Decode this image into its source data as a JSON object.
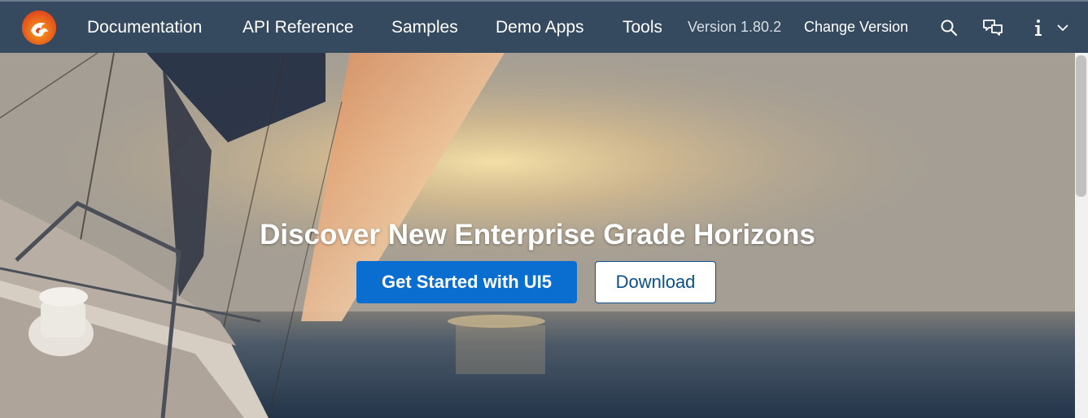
{
  "header": {
    "logo_icon": "ui5-phoenix-logo",
    "nav": [
      {
        "label": "Documentation"
      },
      {
        "label": "API Reference"
      },
      {
        "label": "Samples"
      },
      {
        "label": "Demo Apps"
      },
      {
        "label": "Tools"
      }
    ],
    "version_label": "Version 1.80.2",
    "change_version_label": "Change Version",
    "icons": [
      "search-icon",
      "feedback-icon",
      "info-icon",
      "chevron-down-icon"
    ],
    "background_color": "#354a5f"
  },
  "hero": {
    "title": "Discover New Enterprise Grade Horizons",
    "primary_button": "Get Started with UI5",
    "secondary_button": "Download",
    "primary_color": "#0a6ed1"
  }
}
